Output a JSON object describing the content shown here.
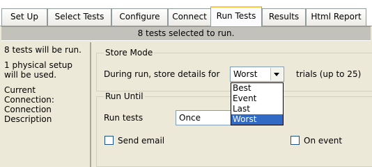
{
  "tabs": [
    {
      "label": "Set Up",
      "active": false
    },
    {
      "label": "Select Tests",
      "active": false
    },
    {
      "label": "Configure",
      "active": false
    },
    {
      "label": "Connect",
      "active": false
    },
    {
      "label": "Run Tests",
      "active": true
    },
    {
      "label": "Results",
      "active": false
    },
    {
      "label": "Html Report",
      "active": false
    }
  ],
  "status_bar": {
    "text": "8 tests selected to run."
  },
  "left_panel": {
    "tests_info": "8 tests will be run.",
    "setup_info": "1 physical setup will be used.",
    "connection_label": "Current Connection:",
    "description_label": "Connection Description"
  },
  "store_mode": {
    "title": "Store Mode",
    "prefix_label": "During run, store details for",
    "selected_value": "Worst",
    "suffix_label": "trials (up to 25)",
    "options": [
      "Best",
      "Event",
      "Last",
      "Worst"
    ],
    "highlighted_option": "Worst"
  },
  "run_until": {
    "title": "Run Until",
    "run_tests_label": "Run tests",
    "run_tests_value": "Once",
    "send_email_label": "Send email",
    "send_email_checked": false,
    "on_event_label": "On event",
    "on_event_checked": false
  },
  "colors": {
    "background": "#ece9d8",
    "selection_highlight": "#316ac5",
    "active_tab_accent": "#ffc83c",
    "status_bar": "#c2c1ba"
  }
}
